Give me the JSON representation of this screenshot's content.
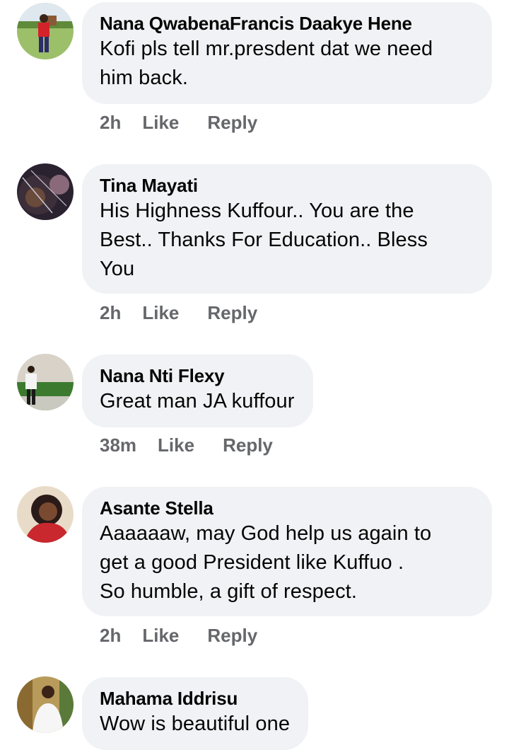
{
  "comments": [
    {
      "author": "Nana QwabenaFrancis Daakye Hene",
      "text": [
        "Kofi pls tell mr.presdent dat we need",
        "him back."
      ],
      "time": "2h",
      "like_label": "Like",
      "reply_label": "Reply"
    },
    {
      "author": "Tina Mayati",
      "text": [
        "His Highness Kuffour.. You are the",
        "Best.. Thanks For Education.. Bless",
        "You"
      ],
      "time": "2h",
      "like_label": "Like",
      "reply_label": "Reply"
    },
    {
      "author": "Nana Nti Flexy",
      "text": [
        "Great man JA kuffour"
      ],
      "time": "38m",
      "like_label": "Like",
      "reply_label": "Reply"
    },
    {
      "author": "Asante Stella",
      "text": [
        "Aaaaaaw, may God help us again to",
        "get a good President like Kuffuo .",
        "So humble, a gift of respect."
      ],
      "time": "2h",
      "like_label": "Like",
      "reply_label": "Reply"
    },
    {
      "author": "Mahama Iddrisu",
      "text": [
        "Wow is beautiful one"
      ],
      "time": "",
      "like_label": "",
      "reply_label": ""
    }
  ],
  "colors": {
    "bubble_bg": "#f0f2f5",
    "name_text": "#050505",
    "meta_text": "#65676b"
  }
}
